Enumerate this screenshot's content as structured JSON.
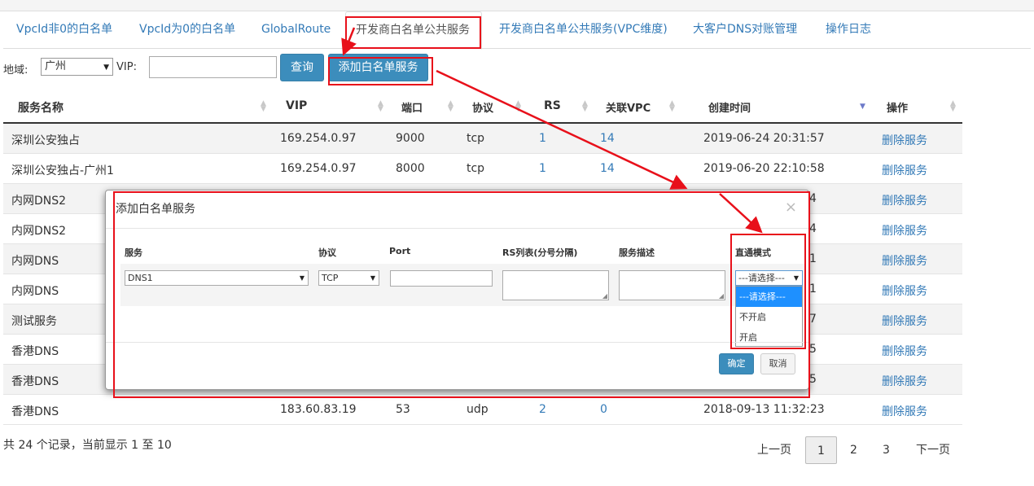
{
  "tabs": [
    {
      "label": "VpcId非0的白名单"
    },
    {
      "label": "VpcId为0的白名单"
    },
    {
      "label": "GlobalRoute"
    },
    {
      "label": "开发商白名单公共服务"
    },
    {
      "label": "开发商白名单公共服务(VPC维度)"
    },
    {
      "label": "大客户DNS对账管理"
    },
    {
      "label": "操作日志"
    }
  ],
  "filters": {
    "region_label": "地域:",
    "region_value": "广州",
    "vip_label": "VIP:",
    "vip_value": "",
    "query_button": "查询",
    "add_button": "添加白名单服务"
  },
  "table": {
    "headers": [
      "服务名称",
      "VIP",
      "端口",
      "协议",
      "RS",
      "关联VPC",
      "创建时间",
      "操作"
    ],
    "rows": [
      {
        "name": "深圳公安独占",
        "vip": "169.254.0.97",
        "port": "9000",
        "proto": "tcp",
        "rs": "1",
        "vpc": "14",
        "time": "2019-06-24 20:31:57",
        "action": "删除服务"
      },
      {
        "name": "深圳公安独占-广州1",
        "vip": "169.254.0.97",
        "port": "8000",
        "proto": "tcp",
        "rs": "1",
        "vpc": "14",
        "time": "2019-06-20 22:10:58",
        "action": "删除服务"
      },
      {
        "name": "内网DNS2",
        "time": "4",
        "action": "删除服务"
      },
      {
        "name": "内网DNS2",
        "time": "4",
        "action": "删除服务"
      },
      {
        "name": "内网DNS",
        "time": "1",
        "action": "删除服务"
      },
      {
        "name": "内网DNS",
        "time": "1",
        "action": "删除服务"
      },
      {
        "name": "测试服务",
        "time": "7",
        "action": "删除服务"
      },
      {
        "name": "香港DNS",
        "time": "5",
        "action": "删除服务"
      },
      {
        "name": "香港DNS",
        "time": "5",
        "action": "删除服务"
      },
      {
        "name": "香港DNS",
        "vip": "183.60.83.19",
        "port": "53",
        "proto": "udp",
        "rs": "2",
        "vpc": "0",
        "time": "2018-09-13 11:32:23",
        "action": "删除服务"
      }
    ]
  },
  "footer": {
    "summary": "共 24 个记录，当前显示 1 至 10",
    "prev": "上一页",
    "pages": [
      "1",
      "2",
      "3"
    ],
    "next": "下一页"
  },
  "modal": {
    "title": "添加白名单服务",
    "close": "×",
    "headers": {
      "service": "服务",
      "proto": "协议",
      "port": "Port",
      "rs": "RS列表(分号分隔)",
      "desc": "服务描述",
      "mode": "直通模式"
    },
    "service_value": "DNS1",
    "proto_value": "TCP",
    "mode_value": "---请选择---",
    "mode_options": [
      "---请选择---",
      "不开启",
      "开启"
    ],
    "ok": "确定",
    "cancel": "取消"
  },
  "colors": {
    "accent": "#3c8dbc",
    "link": "#337ab7",
    "annotation": "#e8101a"
  }
}
